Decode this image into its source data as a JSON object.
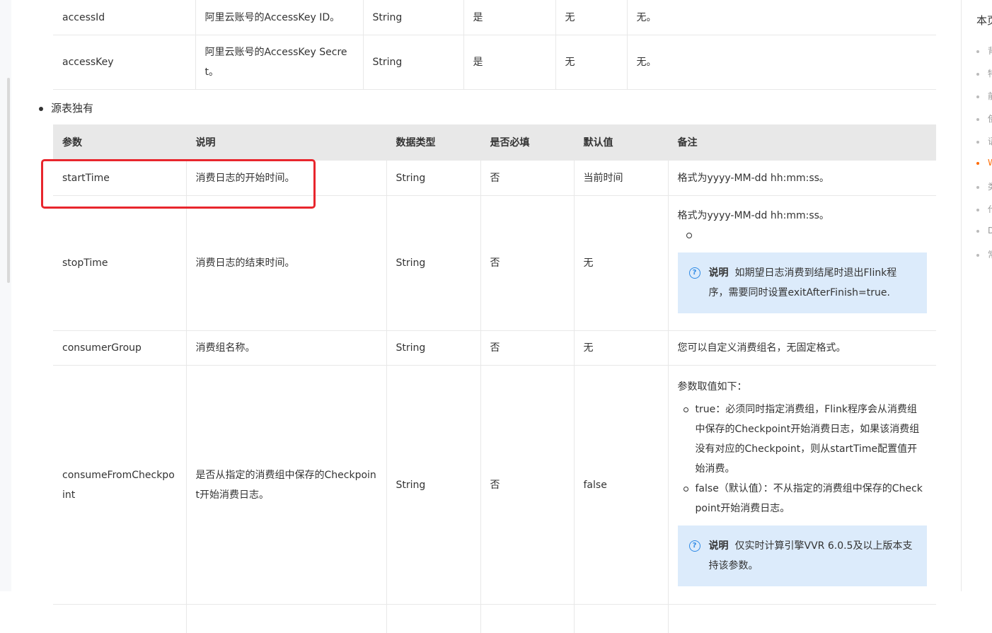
{
  "table1": {
    "rows": [
      {
        "param": "accessId",
        "desc": "阿里云账号的AccessKey ID。",
        "type": "String",
        "required": "是",
        "default": "无",
        "remark": "无。"
      },
      {
        "param": "accessKey",
        "desc": "阿里云账号的AccessKey Secret。",
        "type": "String",
        "required": "是",
        "default": "无",
        "remark": "无。"
      }
    ]
  },
  "section": {
    "bullet": "源表独有"
  },
  "table2": {
    "headers": {
      "param": "参数",
      "desc": "说明",
      "type": "数据类型",
      "required": "是否必填",
      "default": "默认值",
      "remark": "备注"
    },
    "startTime": {
      "param": "startTime",
      "desc": "消费日志的开始时间。",
      "type": "String",
      "required": "否",
      "default": "当前时间",
      "remark": "格式为yyyy-MM-dd hh:mm:ss。"
    },
    "stopTime": {
      "param": "stopTime",
      "desc": "消费日志的结束时间。",
      "type": "String",
      "required": "否",
      "default": "无",
      "remark": "格式为yyyy-MM-dd hh:mm:ss。",
      "note_title": "说明",
      "note_text": "如期望日志消费到结尾时退出Flink程序，需要同时设置exitAfterFinish=true."
    },
    "consumerGroup": {
      "param": "consumerGroup",
      "desc": "消费组名称。",
      "type": "String",
      "required": "否",
      "default": "无",
      "remark": "您可以自定义消费组名，无固定格式。"
    },
    "consumeFromCheckpoint": {
      "param": "consumeFromCheckpoint",
      "desc": "是否从指定的消费组中保存的Checkpoint开始消费日志。",
      "type": "String",
      "required": "否",
      "default": "false",
      "remark_intro": "参数取值如下：",
      "options": [
        "true：必须同时指定消费组，Flink程序会从消费组中保存的Checkpoint开始消费日志，如果该消费组没有对应的Checkpoint，则从startTime配置值开始消费。",
        "false（默认值）：不从指定的消费组中保存的Checkpoint开始消费日志。"
      ],
      "note_title": "说明",
      "note_text": "仅实时计算引擎VVR 6.0.5及以上版本支持该参数。"
    }
  },
  "toc": {
    "title": "本页",
    "items": [
      {
        "label": "背",
        "active": false
      },
      {
        "label": "特",
        "active": false
      },
      {
        "label": "前",
        "active": false
      },
      {
        "label": "使",
        "active": false
      },
      {
        "label": "语",
        "active": false
      },
      {
        "label": "W",
        "active": true
      },
      {
        "label": "类",
        "active": false
      },
      {
        "label": "代",
        "active": false
      },
      {
        "label": "D",
        "active": false
      },
      {
        "label": "常",
        "active": false
      }
    ]
  }
}
